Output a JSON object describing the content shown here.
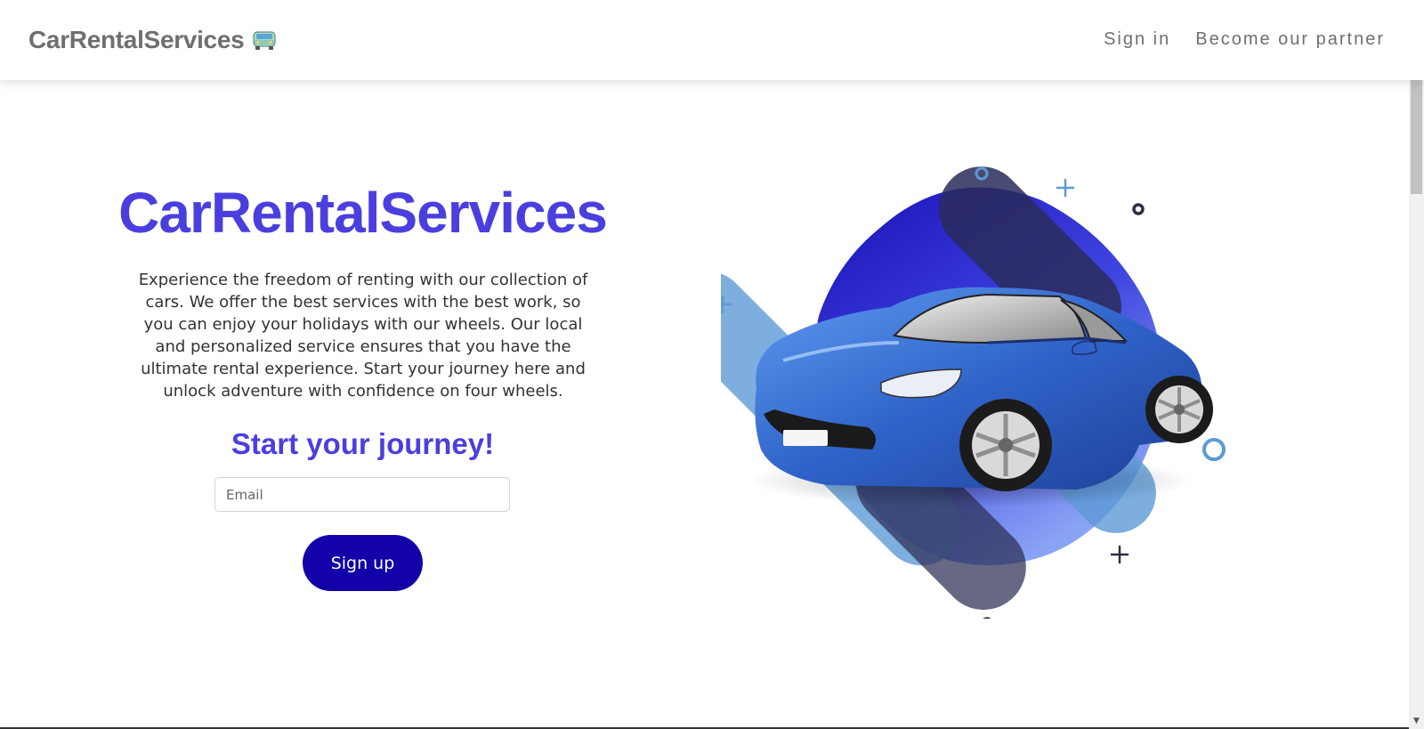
{
  "navbar": {
    "brand": "CarRentalServices",
    "brand_icon": "car-icon",
    "links": [
      "Sign in",
      "Become our partner"
    ]
  },
  "hero": {
    "title": "CarRentalServices",
    "description": "Experience the freedom of renting with our collection of cars. We offer the best services with the best work, so you can enjoy your holidays with our wheels. Our local and personalized service ensures that you have the ultimate rental experience. Start your journey here and unlock adventure with confidence on four wheels.",
    "subtitle": "Start your journey!",
    "email_placeholder": "Email",
    "signup_label": "Sign up",
    "illustration": "blue-sports-car-illustration"
  },
  "colors": {
    "accent": "#4a3fde",
    "button": "#1200a8",
    "nav_text": "#6f6f6f"
  }
}
